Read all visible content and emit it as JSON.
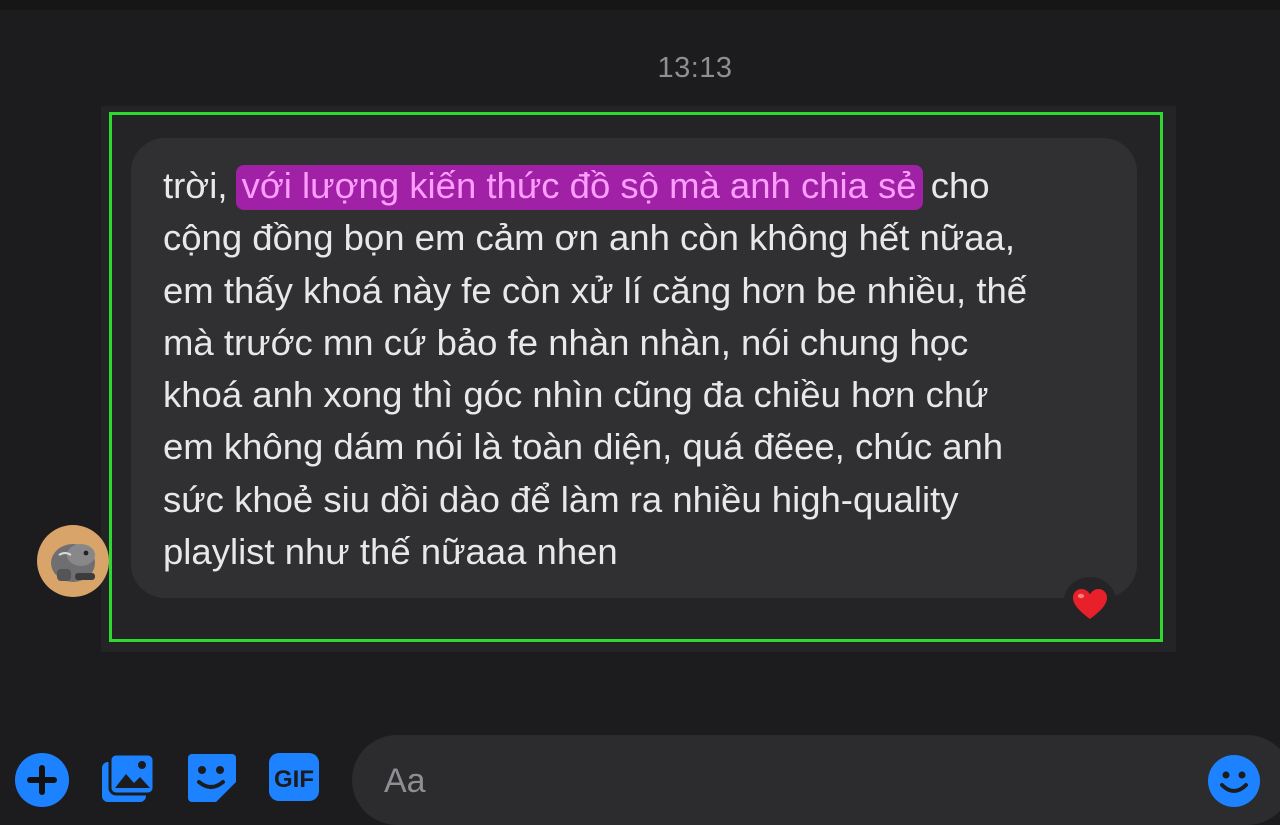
{
  "conversation": {
    "timestamp": "13:13"
  },
  "message": {
    "lines": [
      {
        "before": "trời, ",
        "highlight": "với lượng kiến thức đồ sộ mà anh chia sẻ",
        "after": " cho"
      },
      {
        "text": "cộng đồng bọn em cảm ơn anh còn không hết nữaa,"
      },
      {
        "text": "em thấy khoá này fe còn xử lí căng hơn be nhiều, thế"
      },
      {
        "text": "mà trước mn cứ bảo fe nhàn nhàn, nói chung học"
      },
      {
        "text": "khoá anh xong thì góc nhìn cũng đa chiều hơn chứ"
      },
      {
        "text": "em không dám nói là toàn diện, quá đẽee, chúc anh"
      },
      {
        "text": "sức khoẻ siu dồi dào để làm ra nhiều high-quality"
      },
      {
        "text": "playlist như thế nữaaa nhen"
      }
    ],
    "reaction_icon": "red-heart-icon",
    "sender_avatar_icon": "avatar-icon"
  },
  "composer": {
    "placeholder": "Aa",
    "gif_label": "GIF",
    "tools": [
      "plus-icon",
      "photo-icon",
      "sticker-icon",
      "gif-icon",
      "emoji-icon"
    ]
  },
  "colors": {
    "background": "#1c1c1e",
    "bubble": "#303033",
    "highlight_bg": "#a021a6",
    "highlight_text": "#ff9dff",
    "selection_frame": "#2ed832",
    "accent": "#1d82ff"
  }
}
